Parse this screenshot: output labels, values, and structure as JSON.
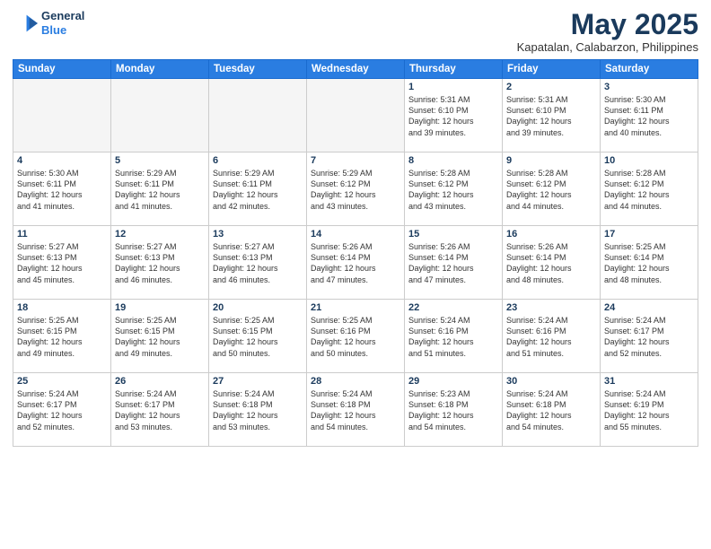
{
  "header": {
    "logo_line1": "General",
    "logo_line2": "Blue",
    "month_year": "May 2025",
    "location": "Kapatalan, Calabarzon, Philippines"
  },
  "weekdays": [
    "Sunday",
    "Monday",
    "Tuesday",
    "Wednesday",
    "Thursday",
    "Friday",
    "Saturday"
  ],
  "weeks": [
    [
      {
        "day": "",
        "text": ""
      },
      {
        "day": "",
        "text": ""
      },
      {
        "day": "",
        "text": ""
      },
      {
        "day": "",
        "text": ""
      },
      {
        "day": "1",
        "text": "Sunrise: 5:31 AM\nSunset: 6:10 PM\nDaylight: 12 hours\nand 39 minutes."
      },
      {
        "day": "2",
        "text": "Sunrise: 5:31 AM\nSunset: 6:10 PM\nDaylight: 12 hours\nand 39 minutes."
      },
      {
        "day": "3",
        "text": "Sunrise: 5:30 AM\nSunset: 6:11 PM\nDaylight: 12 hours\nand 40 minutes."
      }
    ],
    [
      {
        "day": "4",
        "text": "Sunrise: 5:30 AM\nSunset: 6:11 PM\nDaylight: 12 hours\nand 41 minutes."
      },
      {
        "day": "5",
        "text": "Sunrise: 5:29 AM\nSunset: 6:11 PM\nDaylight: 12 hours\nand 41 minutes."
      },
      {
        "day": "6",
        "text": "Sunrise: 5:29 AM\nSunset: 6:11 PM\nDaylight: 12 hours\nand 42 minutes."
      },
      {
        "day": "7",
        "text": "Sunrise: 5:29 AM\nSunset: 6:12 PM\nDaylight: 12 hours\nand 43 minutes."
      },
      {
        "day": "8",
        "text": "Sunrise: 5:28 AM\nSunset: 6:12 PM\nDaylight: 12 hours\nand 43 minutes."
      },
      {
        "day": "9",
        "text": "Sunrise: 5:28 AM\nSunset: 6:12 PM\nDaylight: 12 hours\nand 44 minutes."
      },
      {
        "day": "10",
        "text": "Sunrise: 5:28 AM\nSunset: 6:12 PM\nDaylight: 12 hours\nand 44 minutes."
      }
    ],
    [
      {
        "day": "11",
        "text": "Sunrise: 5:27 AM\nSunset: 6:13 PM\nDaylight: 12 hours\nand 45 minutes."
      },
      {
        "day": "12",
        "text": "Sunrise: 5:27 AM\nSunset: 6:13 PM\nDaylight: 12 hours\nand 46 minutes."
      },
      {
        "day": "13",
        "text": "Sunrise: 5:27 AM\nSunset: 6:13 PM\nDaylight: 12 hours\nand 46 minutes."
      },
      {
        "day": "14",
        "text": "Sunrise: 5:26 AM\nSunset: 6:14 PM\nDaylight: 12 hours\nand 47 minutes."
      },
      {
        "day": "15",
        "text": "Sunrise: 5:26 AM\nSunset: 6:14 PM\nDaylight: 12 hours\nand 47 minutes."
      },
      {
        "day": "16",
        "text": "Sunrise: 5:26 AM\nSunset: 6:14 PM\nDaylight: 12 hours\nand 48 minutes."
      },
      {
        "day": "17",
        "text": "Sunrise: 5:25 AM\nSunset: 6:14 PM\nDaylight: 12 hours\nand 48 minutes."
      }
    ],
    [
      {
        "day": "18",
        "text": "Sunrise: 5:25 AM\nSunset: 6:15 PM\nDaylight: 12 hours\nand 49 minutes."
      },
      {
        "day": "19",
        "text": "Sunrise: 5:25 AM\nSunset: 6:15 PM\nDaylight: 12 hours\nand 49 minutes."
      },
      {
        "day": "20",
        "text": "Sunrise: 5:25 AM\nSunset: 6:15 PM\nDaylight: 12 hours\nand 50 minutes."
      },
      {
        "day": "21",
        "text": "Sunrise: 5:25 AM\nSunset: 6:16 PM\nDaylight: 12 hours\nand 50 minutes."
      },
      {
        "day": "22",
        "text": "Sunrise: 5:24 AM\nSunset: 6:16 PM\nDaylight: 12 hours\nand 51 minutes."
      },
      {
        "day": "23",
        "text": "Sunrise: 5:24 AM\nSunset: 6:16 PM\nDaylight: 12 hours\nand 51 minutes."
      },
      {
        "day": "24",
        "text": "Sunrise: 5:24 AM\nSunset: 6:17 PM\nDaylight: 12 hours\nand 52 minutes."
      }
    ],
    [
      {
        "day": "25",
        "text": "Sunrise: 5:24 AM\nSunset: 6:17 PM\nDaylight: 12 hours\nand 52 minutes."
      },
      {
        "day": "26",
        "text": "Sunrise: 5:24 AM\nSunset: 6:17 PM\nDaylight: 12 hours\nand 53 minutes."
      },
      {
        "day": "27",
        "text": "Sunrise: 5:24 AM\nSunset: 6:18 PM\nDaylight: 12 hours\nand 53 minutes."
      },
      {
        "day": "28",
        "text": "Sunrise: 5:24 AM\nSunset: 6:18 PM\nDaylight: 12 hours\nand 54 minutes."
      },
      {
        "day": "29",
        "text": "Sunrise: 5:23 AM\nSunset: 6:18 PM\nDaylight: 12 hours\nand 54 minutes."
      },
      {
        "day": "30",
        "text": "Sunrise: 5:24 AM\nSunset: 6:18 PM\nDaylight: 12 hours\nand 54 minutes."
      },
      {
        "day": "31",
        "text": "Sunrise: 5:24 AM\nSunset: 6:19 PM\nDaylight: 12 hours\nand 55 minutes."
      }
    ]
  ]
}
